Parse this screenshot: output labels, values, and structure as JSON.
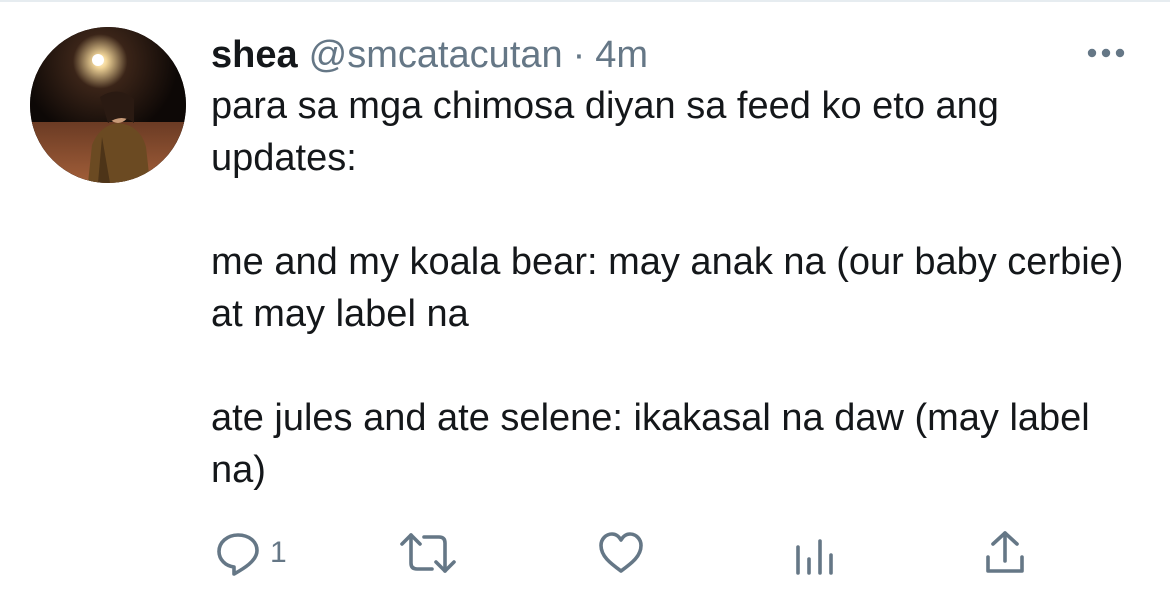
{
  "tweet": {
    "display_name": "shea",
    "handle": "@smcatacutan",
    "separator": "·",
    "time": "4m",
    "paragraphs": [
      "para sa mga chimosa diyan sa feed ko eto ang updates:",
      "me and my koala bear: may anak na (our baby cerbie) at may label na",
      "ate jules and ate selene: ikakasal na daw (may label na)"
    ]
  },
  "actions": {
    "reply_count": "1",
    "icons": [
      "reply-icon",
      "retweet-icon",
      "like-icon",
      "analytics-icon",
      "share-icon"
    ]
  },
  "colors": {
    "text": "#14171a",
    "secondary": "#657786",
    "divider": "#e6ecf0",
    "icon": "#657786"
  }
}
